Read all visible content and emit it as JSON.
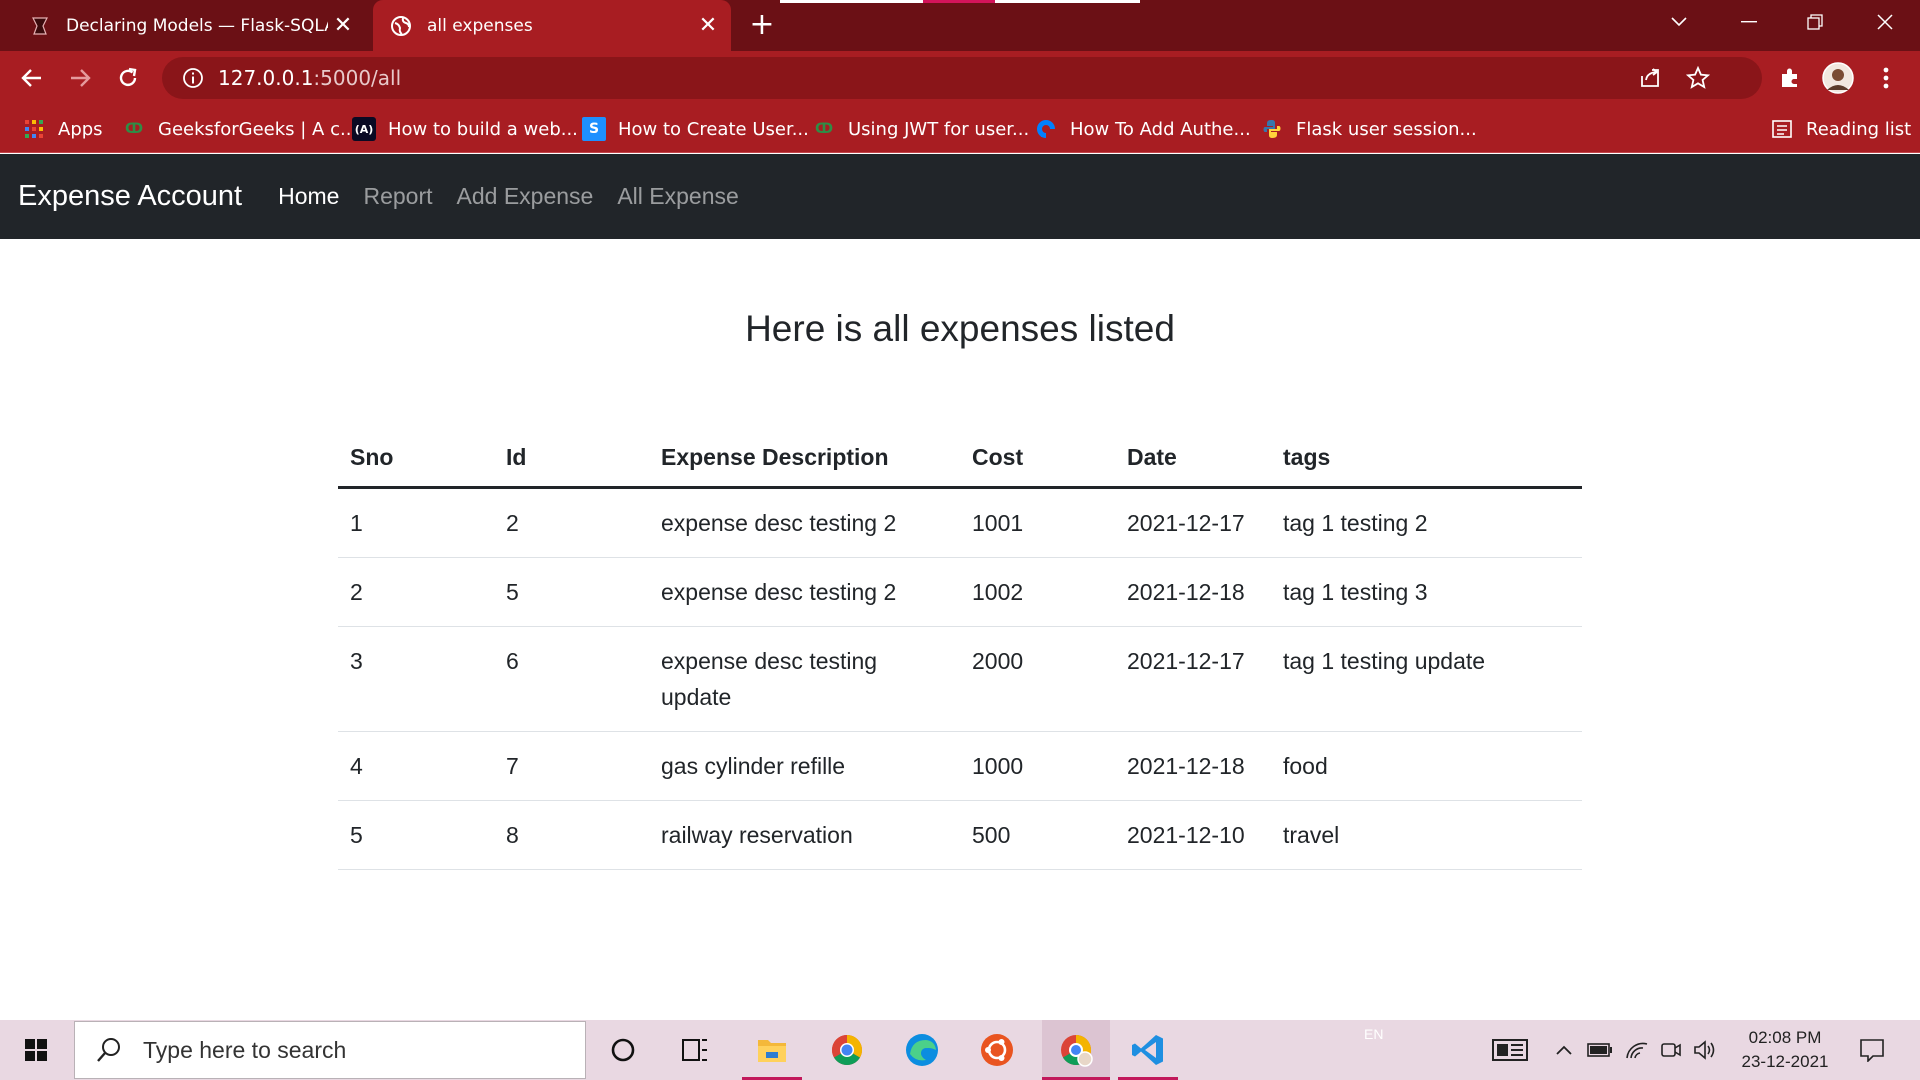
{
  "browser": {
    "tabs": [
      {
        "title": "Declaring Models — Flask-SQLAlchemy",
        "active": false
      },
      {
        "title": "all expenses",
        "active": true
      }
    ],
    "url_host": "127.0.0.1",
    "url_path": ":5000/all",
    "bookmarks": [
      {
        "label": "Apps",
        "icon": "apps-grid-icon"
      },
      {
        "label": "GeeksforGeeks | A c...",
        "icon": "gfg-icon"
      },
      {
        "label": "How to build a web...",
        "icon": "dev-icon"
      },
      {
        "label": "How to Create User...",
        "icon": "s-icon"
      },
      {
        "label": "Using JWT for user...",
        "icon": "gfg-icon"
      },
      {
        "label": "How To Add Authe...",
        "icon": "do-icon"
      },
      {
        "label": "Flask user session...",
        "icon": "python-icon"
      }
    ],
    "reading_list": "Reading list"
  },
  "navbar": {
    "brand": "Expense Account",
    "links": [
      "Home",
      "Report",
      "Add Expense",
      "All Expense"
    ]
  },
  "page": {
    "heading": "Here is all expenses listed"
  },
  "table": {
    "headers": [
      "Sno",
      "Id",
      "Expense Description",
      "Cost",
      "Date",
      "tags"
    ],
    "rows": [
      [
        "1",
        "2",
        "expense desc testing 2",
        "1001",
        "2021-12-17",
        "tag 1 testing 2"
      ],
      [
        "2",
        "5",
        "expense desc testing 2",
        "1002",
        "2021-12-18",
        "tag 1 testing 3"
      ],
      [
        "3",
        "6",
        "expense desc testing update",
        "2000",
        "2021-12-17",
        "tag 1 testing update"
      ],
      [
        "4",
        "7",
        "gas cylinder refille",
        "1000",
        "2021-12-18",
        "food"
      ],
      [
        "5",
        "8",
        "railway reservation",
        "500",
        "2021-12-10",
        "travel"
      ]
    ]
  },
  "taskbar": {
    "search_placeholder": "Type here to search",
    "language": "EN",
    "time": "02:08 PM",
    "date": "23-12-2021"
  },
  "colors": {
    "tabstrip": "#6b1015",
    "toolbar": "#a81d22",
    "navbar": "#212529"
  }
}
